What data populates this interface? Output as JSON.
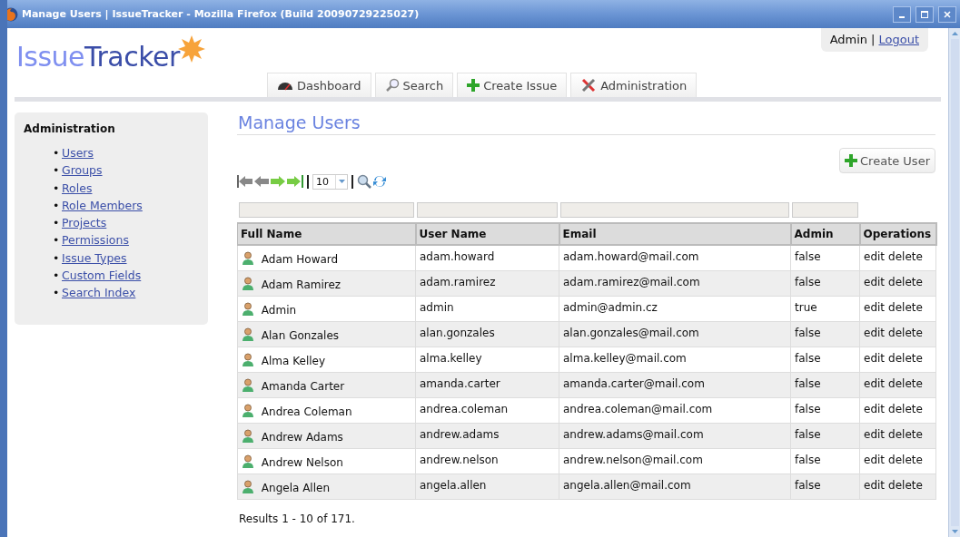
{
  "window": {
    "title": "Manage Users | IssueTracker - Mozilla Firefox (Build 20090729225027)"
  },
  "logo": {
    "light": "Issue",
    "dark": "Tracker"
  },
  "user_box": {
    "user": "Admin",
    "separator": "|",
    "logout": "Logout"
  },
  "tabs": [
    {
      "label": "Dashboard",
      "kind": "gauge",
      "selected": false
    },
    {
      "label": "Search",
      "kind": "search",
      "selected": false
    },
    {
      "label": "Create Issue",
      "kind": "create",
      "selected": false
    },
    {
      "label": "Administration",
      "kind": "tools",
      "selected": false
    }
  ],
  "sidebar": {
    "title": "Administration",
    "items": [
      {
        "bullet": "•",
        "label": "Users"
      },
      {
        "bullet": "•",
        "label": "Groups"
      },
      {
        "bullet": "•",
        "label": "Roles"
      },
      {
        "bullet": "•",
        "label": "Role Members"
      },
      {
        "bullet": "•",
        "label": "Projects"
      },
      {
        "bullet": "•",
        "label": "Permissions"
      },
      {
        "bullet": "•",
        "label": "Issue Types"
      },
      {
        "bullet": "•",
        "label": "Custom Fields"
      },
      {
        "bullet": "•",
        "label": "Search Index"
      }
    ]
  },
  "page_title": "Manage Users",
  "create_button": "Create User",
  "pager": {
    "page_size": "10"
  },
  "table": {
    "columns": [
      {
        "label": "Full Name",
        "filter": true
      },
      {
        "label": "User Name",
        "filter": true
      },
      {
        "label": "Email",
        "filter": true
      },
      {
        "label": "Admin",
        "filter": true
      },
      {
        "label": "Operations",
        "filter": false
      }
    ],
    "rows": [
      {
        "full_name": "Adam Howard",
        "user_name": "adam.howard",
        "email": "adam.howard@mail.com",
        "admin": "false",
        "operations": [
          "edit",
          "delete"
        ]
      },
      {
        "full_name": "Adam Ramirez",
        "user_name": "adam.ramirez",
        "email": "adam.ramirez@mail.com",
        "admin": "false",
        "operations": [
          "edit",
          "delete"
        ]
      },
      {
        "full_name": "Admin",
        "user_name": "admin",
        "email": "admin@admin.cz",
        "admin": "true",
        "operations": [
          "edit",
          "delete"
        ]
      },
      {
        "full_name": "Alan Gonzales",
        "user_name": "alan.gonzales",
        "email": "alan.gonzales@mail.com",
        "admin": "false",
        "operations": [
          "edit",
          "delete"
        ]
      },
      {
        "full_name": "Alma Kelley",
        "user_name": "alma.kelley",
        "email": "alma.kelley@mail.com",
        "admin": "false",
        "operations": [
          "edit",
          "delete"
        ]
      },
      {
        "full_name": "Amanda Carter",
        "user_name": "amanda.carter",
        "email": "amanda.carter@mail.com",
        "admin": "false",
        "operations": [
          "edit",
          "delete"
        ]
      },
      {
        "full_name": "Andrea Coleman",
        "user_name": "andrea.coleman",
        "email": "andrea.coleman@mail.com",
        "admin": "false",
        "operations": [
          "edit",
          "delete"
        ]
      },
      {
        "full_name": "Andrew Adams",
        "user_name": "andrew.adams",
        "email": "andrew.adams@mail.com",
        "admin": "false",
        "operations": [
          "edit",
          "delete"
        ]
      },
      {
        "full_name": "Andrew Nelson",
        "user_name": "andrew.nelson",
        "email": "andrew.nelson@mail.com",
        "admin": "false",
        "operations": [
          "edit",
          "delete"
        ]
      },
      {
        "full_name": "Angela Allen",
        "user_name": "angela.allen",
        "email": "angela.allen@mail.com",
        "admin": "false",
        "operations": [
          "edit",
          "delete"
        ]
      }
    ]
  },
  "results": "Results 1 - 10 of 171."
}
